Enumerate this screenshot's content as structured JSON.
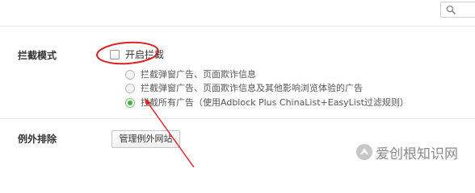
{
  "settings": {
    "block_mode_label": "拦截模式",
    "enable_block_label": "开启拦截",
    "options": [
      {
        "label": "拦截弹窗广告、页面欺诈信息",
        "selected": false
      },
      {
        "label": "拦截弹窗广告、页面欺诈信息及其他影响浏览体验的广告",
        "selected": false
      },
      {
        "label": "拦截所有广告（使用Adblock Plus ChinaList+EasyList过滤规则）",
        "selected": true
      }
    ],
    "exceptions_label": "例外排除",
    "manage_sites_button": "管理例外网站"
  },
  "search": {
    "icon": "search-icon"
  },
  "annotation": {
    "color": "#e02020"
  },
  "watermark": {
    "text": "爱创根知识网"
  }
}
